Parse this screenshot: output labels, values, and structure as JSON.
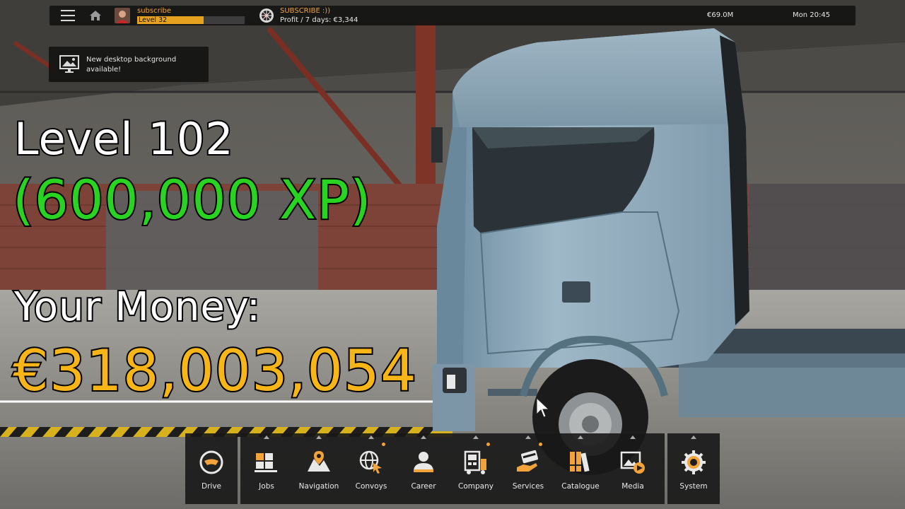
{
  "topbar": {
    "profile_name": "subscribe",
    "level_label": "Level 32",
    "level_progress": 0.62,
    "convoy_title": "SUBSCRIBE :))",
    "profit_text": "Profit / 7 days: €3,344",
    "money": "€69.0M",
    "clock": "Mon 20:45"
  },
  "notification": {
    "text": "New desktop background available!"
  },
  "overlay": {
    "level": "Level 102",
    "xp": "(600,000 XP)",
    "money_label": "Your Money:",
    "money": "€318,003,054"
  },
  "dock": {
    "drive": "Drive",
    "jobs": "Jobs",
    "navigation": "Navigation",
    "convoys": "Convoys",
    "career": "Career",
    "company": "Company",
    "services": "Services",
    "catalogue": "Catalogue",
    "media": "Media",
    "system": "System"
  },
  "colors": {
    "accent_orange": "#f2a43a",
    "xp_green": "#28d421",
    "money_yellow": "#f7b517",
    "truck_blue": "#8fa9b9"
  }
}
